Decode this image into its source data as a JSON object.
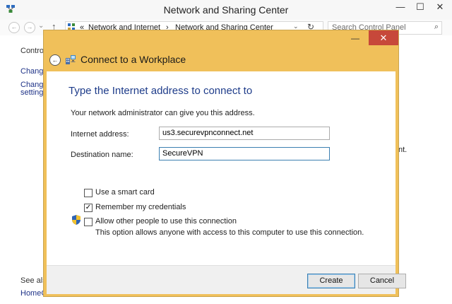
{
  "window": {
    "title": "Network and Sharing Center",
    "controls": {
      "minimize": "—",
      "maximize": "☐",
      "close": "✕"
    }
  },
  "nav": {
    "back": "←",
    "forward": "→",
    "history": "⌄",
    "up": "↑",
    "address": {
      "prefix": "«",
      "crumb1": "Network and Internet",
      "separator": "›",
      "crumb2": "Network and Sharing Center",
      "dropdown": "⌄",
      "refresh": "↻"
    },
    "search": {
      "placeholder": "Search Control Panel",
      "icon": "⌕"
    }
  },
  "sidebar": {
    "item1": "Control",
    "item2": "Change",
    "item3a": "Change",
    "item3b": "settings",
    "see_also": "See also",
    "homegroup": "HomeG"
  },
  "background_fragment": "nt.",
  "dialog": {
    "title": "Connect to a Workplace",
    "minimize": "—",
    "close": "✕",
    "back": "←",
    "heading": "Type the Internet address to connect to",
    "instruction": "Your network administrator can give you this address.",
    "internet_address_label": "Internet address:",
    "internet_address_value": "us3.securevpnconnect.net",
    "destination_label": "Destination name:",
    "destination_value": "SecureVPN",
    "smart_card_label": "Use a smart card",
    "remember_label": "Remember my credentials",
    "remember_check": "✓",
    "allow_label": "Allow other people to use this connection",
    "allow_desc": "This option allows anyone with access to this computer to use this connection.",
    "create_label": "Create",
    "cancel_label": "Cancel"
  },
  "colors": {
    "dialog_frame": "#f0c05a",
    "heading": "#1e3c8a",
    "close_button": "#c7483a",
    "link": "#1e3287"
  }
}
